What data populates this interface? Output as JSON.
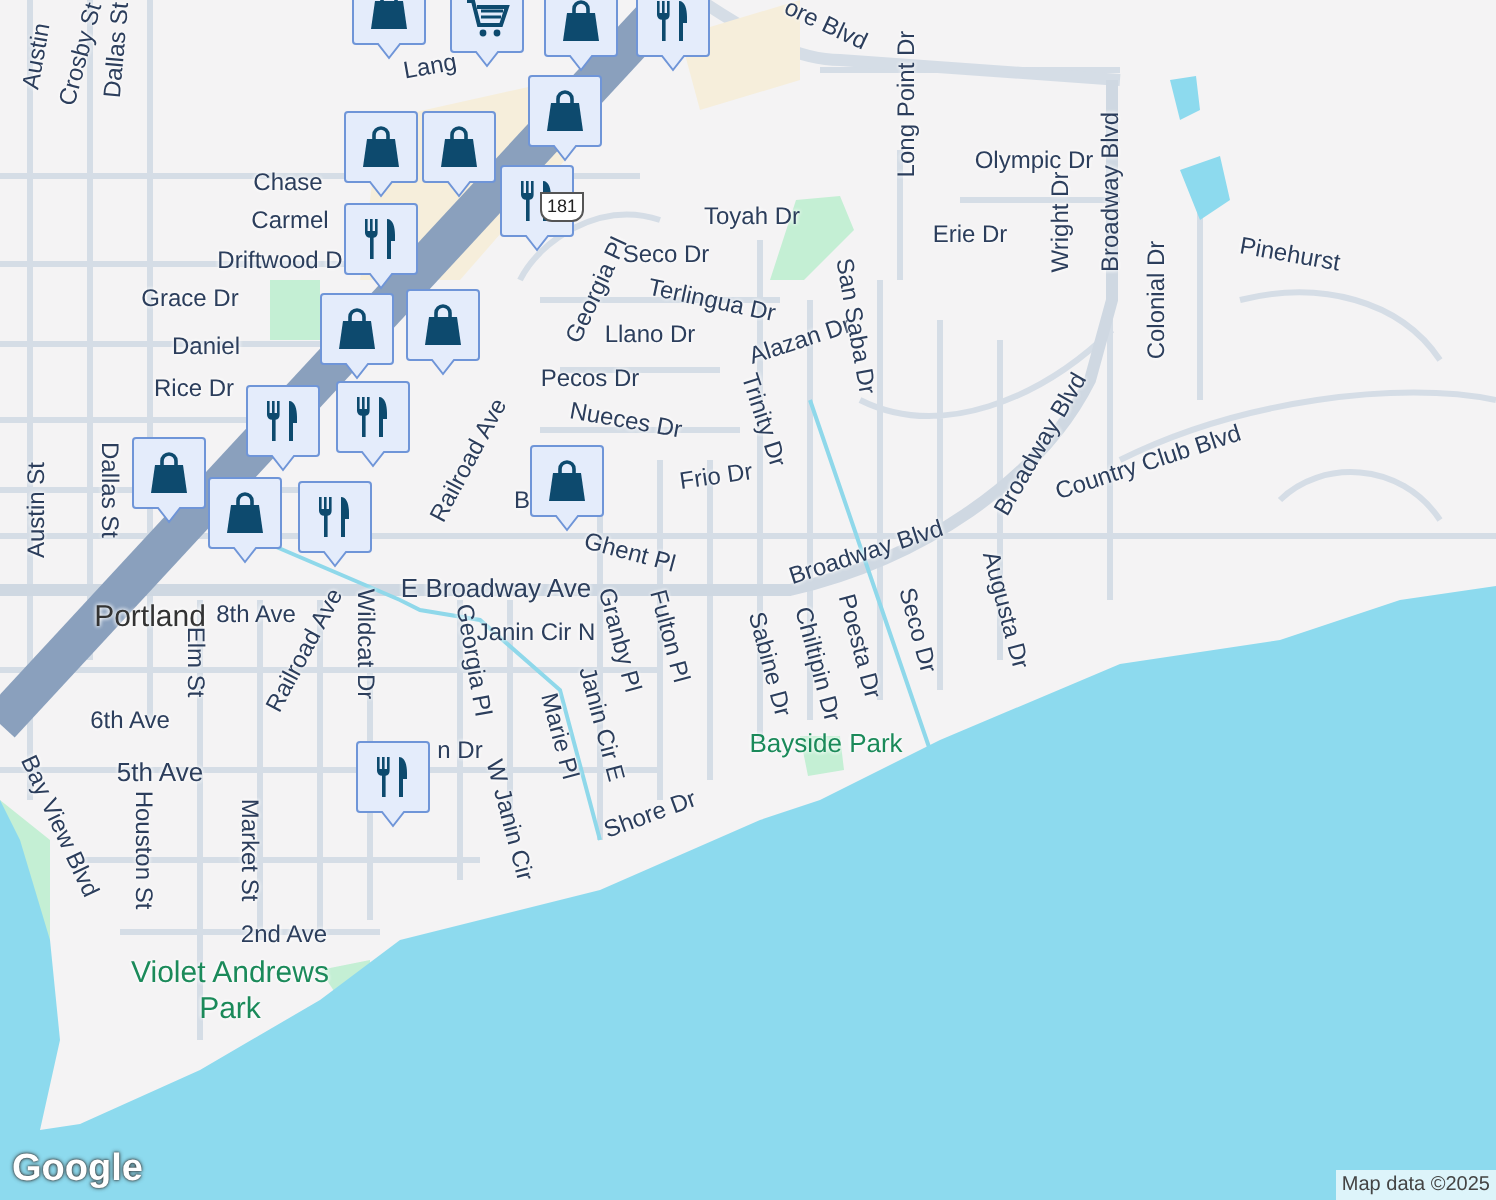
{
  "labels": [
    {
      "text": "Austin",
      "kind": "street"
    },
    {
      "text": "Crosby St",
      "kind": "street"
    },
    {
      "text": "Dallas St",
      "kind": "street"
    },
    {
      "text": "Lang",
      "kind": "street"
    },
    {
      "text": "ore Blvd",
      "kind": "street"
    },
    {
      "text": "Long Point Dr",
      "kind": "street"
    },
    {
      "text": "Olympic Dr",
      "kind": "street"
    },
    {
      "text": "Wright Dr",
      "kind": "street"
    },
    {
      "text": "Broadway Blvd",
      "kind": "street"
    },
    {
      "text": "Erie Dr",
      "kind": "street"
    },
    {
      "text": "Colonial Dr",
      "kind": "street"
    },
    {
      "text": "Pinehurst",
      "kind": "street"
    },
    {
      "text": "Toyah Dr",
      "kind": "street"
    },
    {
      "text": "Seco Dr",
      "kind": "street"
    },
    {
      "text": "Georgia Pl",
      "kind": "street"
    },
    {
      "text": "Terlingua Dr",
      "kind": "street"
    },
    {
      "text": "Llano Dr",
      "kind": "street"
    },
    {
      "text": "Alazan Dr",
      "kind": "street"
    },
    {
      "text": "San Saba Dr",
      "kind": "street"
    },
    {
      "text": "Trinity Dr",
      "kind": "street"
    },
    {
      "text": "Pecos Dr",
      "kind": "street"
    },
    {
      "text": "Nueces Dr",
      "kind": "street"
    },
    {
      "text": "Frio Dr",
      "kind": "street"
    },
    {
      "text": "Broadway Blvd",
      "kind": "street"
    },
    {
      "text": "Country Club Blvd",
      "kind": "street"
    },
    {
      "text": "Broadway Blvd",
      "kind": "street"
    },
    {
      "text": "Chase",
      "kind": "street"
    },
    {
      "text": "Carmel",
      "kind": "street"
    },
    {
      "text": "Driftwood D",
      "kind": "street"
    },
    {
      "text": "Grace Dr",
      "kind": "street"
    },
    {
      "text": "Daniel",
      "kind": "street"
    },
    {
      "text": "Rice Dr",
      "kind": "street"
    },
    {
      "text": "Austin St",
      "kind": "street"
    },
    {
      "text": "Dallas St",
      "kind": "street"
    },
    {
      "text": "Railroad Ave",
      "kind": "street"
    },
    {
      "text": "B",
      "kind": "street"
    },
    {
      "text": "Ghent Pl",
      "kind": "street"
    },
    {
      "text": "E Broadway Ave",
      "kind": "street"
    },
    {
      "text": "Portland",
      "kind": "city"
    },
    {
      "text": "8th Ave",
      "kind": "street"
    },
    {
      "text": "Railroad Ave",
      "kind": "street"
    },
    {
      "text": "Wildcat Dr",
      "kind": "street"
    },
    {
      "text": "Georgia Pl",
      "kind": "street"
    },
    {
      "text": "Janin Cir N",
      "kind": "street"
    },
    {
      "text": "Granby Pl",
      "kind": "street"
    },
    {
      "text": "Fulton Pl",
      "kind": "street"
    },
    {
      "text": "Sabine Dr",
      "kind": "street"
    },
    {
      "text": "Chiltipin Dr",
      "kind": "street"
    },
    {
      "text": "Poesta Dr",
      "kind": "street"
    },
    {
      "text": "Seco Dr",
      "kind": "street"
    },
    {
      "text": "Augusta Dr",
      "kind": "street"
    },
    {
      "text": "Bayside Park",
      "kind": "park"
    },
    {
      "text": "Elm St",
      "kind": "street"
    },
    {
      "text": "6th Ave",
      "kind": "street"
    },
    {
      "text": "5th Ave",
      "kind": "street"
    },
    {
      "text": "n Dr",
      "kind": "street"
    },
    {
      "text": "Marie Pl",
      "kind": "street"
    },
    {
      "text": "Janin Cir E",
      "kind": "street"
    },
    {
      "text": "W Janin Cir",
      "kind": "street"
    },
    {
      "text": "Shore Dr",
      "kind": "street"
    },
    {
      "text": "Bay View Blvd",
      "kind": "street"
    },
    {
      "text": "Houston St",
      "kind": "street"
    },
    {
      "text": "Market St",
      "kind": "street"
    },
    {
      "text": "2nd Ave",
      "kind": "street"
    },
    {
      "text": "Violet Andrews Park",
      "kind": "park"
    }
  ],
  "markers": [
    {
      "kind": "shopping"
    },
    {
      "kind": "grocery"
    },
    {
      "kind": "shopping"
    },
    {
      "kind": "restaurant"
    },
    {
      "kind": "shopping"
    },
    {
      "kind": "shopping"
    },
    {
      "kind": "shopping"
    },
    {
      "kind": "restaurant"
    },
    {
      "kind": "restaurant"
    },
    {
      "kind": "shopping"
    },
    {
      "kind": "shopping"
    },
    {
      "kind": "restaurant"
    },
    {
      "kind": "restaurant"
    },
    {
      "kind": "shopping"
    },
    {
      "kind": "shopping"
    },
    {
      "kind": "restaurant"
    },
    {
      "kind": "shopping"
    },
    {
      "kind": "restaurant"
    }
  ],
  "highway_shield": "181",
  "logo": "Google",
  "attribution": "Map data ©2025"
}
